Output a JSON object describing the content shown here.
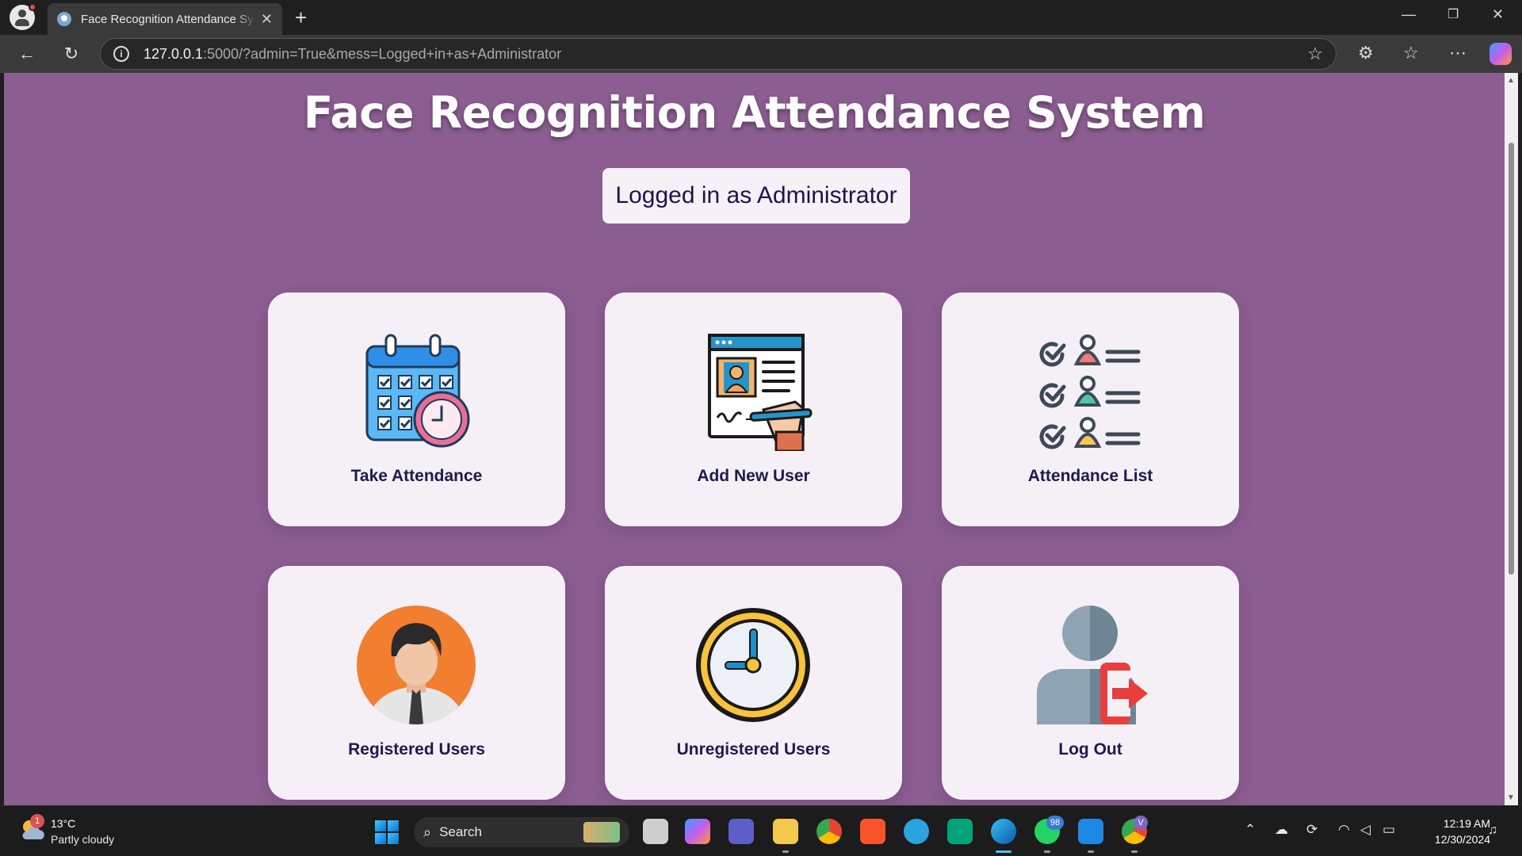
{
  "browser": {
    "tab_title": "Face Recognition Attendance System",
    "url_host": "127.0.0.1",
    "url_rest": ":5000/?admin=True&mess=Logged+in+as+Administrator"
  },
  "page": {
    "title": "Face Recognition Attendance System",
    "status": "Logged in as Administrator",
    "cards": [
      {
        "label": "Take Attendance",
        "icon": "calendar-clock-icon"
      },
      {
        "label": "Add New User",
        "icon": "register-document-icon"
      },
      {
        "label": "Attendance List",
        "icon": "checklist-users-icon"
      },
      {
        "label": "Registered Users",
        "icon": "user-avatar-icon"
      },
      {
        "label": "Unregistered Users",
        "icon": "clock-icon"
      },
      {
        "label": "Log Out",
        "icon": "logout-icon"
      }
    ],
    "colors": {
      "background": "#8b5d91",
      "card": "#f5f0f6",
      "text": "#1e1a4c"
    }
  },
  "taskbar": {
    "weather_temp": "13°C",
    "weather_desc": "Partly cloudy",
    "weather_badge": "1",
    "search_placeholder": "Search",
    "whatsapp_badge": "98",
    "chrome_badge": "V",
    "time": "12:19 AM",
    "date": "12/30/2024"
  }
}
